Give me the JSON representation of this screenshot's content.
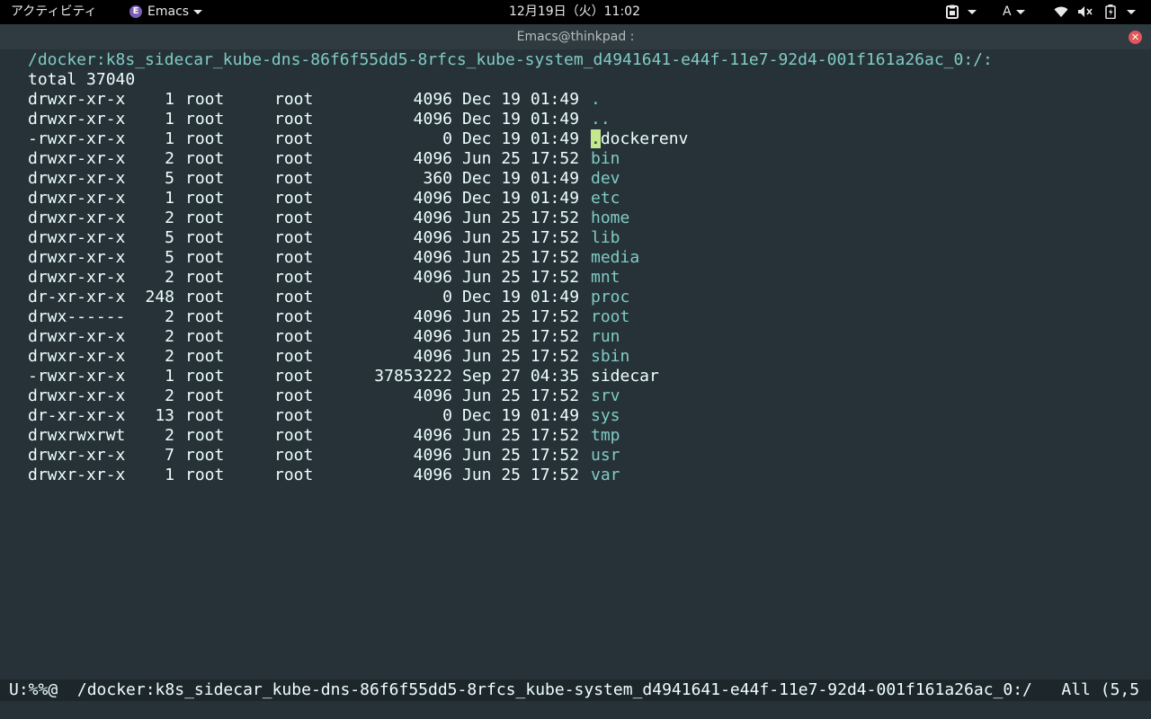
{
  "topbar": {
    "activities": "アクティビティ",
    "app_name": "Emacs",
    "clock": "12月19日（火）11:02",
    "input_method": "A"
  },
  "window": {
    "title": "Emacs@thinkpad :"
  },
  "dired": {
    "header": "/docker:k8s_sidecar_kube-dns-86f6f55dd5-8rfcs_kube-system_d4941641-e44f-11e7-92d4-001f161a26ac_0:/:",
    "total": "total 37040",
    "cursor_char": ".",
    "entries": [
      {
        "perm": "drwxr-xr-x",
        "links": "1",
        "owner": "root",
        "group": "root",
        "size": "4096",
        "date": "Dec 19 01:49",
        "name": "."
      },
      {
        "perm": "drwxr-xr-x",
        "links": "1",
        "owner": "root",
        "group": "root",
        "size": "4096",
        "date": "Dec 19 01:49",
        "name": ".."
      },
      {
        "perm": "-rwxr-xr-x",
        "links": "1",
        "owner": "root",
        "group": "root",
        "size": "0",
        "date": "Dec 19 01:49",
        "name": "dockerenv"
      },
      {
        "perm": "drwxr-xr-x",
        "links": "2",
        "owner": "root",
        "group": "root",
        "size": "4096",
        "date": "Jun 25 17:52",
        "name": "bin"
      },
      {
        "perm": "drwxr-xr-x",
        "links": "5",
        "owner": "root",
        "group": "root",
        "size": "360",
        "date": "Dec 19 01:49",
        "name": "dev"
      },
      {
        "perm": "drwxr-xr-x",
        "links": "1",
        "owner": "root",
        "group": "root",
        "size": "4096",
        "date": "Dec 19 01:49",
        "name": "etc"
      },
      {
        "perm": "drwxr-xr-x",
        "links": "2",
        "owner": "root",
        "group": "root",
        "size": "4096",
        "date": "Jun 25 17:52",
        "name": "home"
      },
      {
        "perm": "drwxr-xr-x",
        "links": "5",
        "owner": "root",
        "group": "root",
        "size": "4096",
        "date": "Jun 25 17:52",
        "name": "lib"
      },
      {
        "perm": "drwxr-xr-x",
        "links": "5",
        "owner": "root",
        "group": "root",
        "size": "4096",
        "date": "Jun 25 17:52",
        "name": "media"
      },
      {
        "perm": "drwxr-xr-x",
        "links": "2",
        "owner": "root",
        "group": "root",
        "size": "4096",
        "date": "Jun 25 17:52",
        "name": "mnt"
      },
      {
        "perm": "dr-xr-xr-x",
        "links": "248",
        "owner": "root",
        "group": "root",
        "size": "0",
        "date": "Dec 19 01:49",
        "name": "proc"
      },
      {
        "perm": "drwx------",
        "links": "2",
        "owner": "root",
        "group": "root",
        "size": "4096",
        "date": "Jun 25 17:52",
        "name": "root"
      },
      {
        "perm": "drwxr-xr-x",
        "links": "2",
        "owner": "root",
        "group": "root",
        "size": "4096",
        "date": "Jun 25 17:52",
        "name": "run"
      },
      {
        "perm": "drwxr-xr-x",
        "links": "2",
        "owner": "root",
        "group": "root",
        "size": "4096",
        "date": "Jun 25 17:52",
        "name": "sbin"
      },
      {
        "perm": "-rwxr-xr-x",
        "links": "1",
        "owner": "root",
        "group": "root",
        "size": "37853222",
        "date": "Sep 27 04:35",
        "name": "sidecar"
      },
      {
        "perm": "drwxr-xr-x",
        "links": "2",
        "owner": "root",
        "group": "root",
        "size": "4096",
        "date": "Jun 25 17:52",
        "name": "srv"
      },
      {
        "perm": "dr-xr-xr-x",
        "links": "13",
        "owner": "root",
        "group": "root",
        "size": "0",
        "date": "Dec 19 01:49",
        "name": "sys"
      },
      {
        "perm": "drwxrwxrwt",
        "links": "2",
        "owner": "root",
        "group": "root",
        "size": "4096",
        "date": "Jun 25 17:52",
        "name": "tmp"
      },
      {
        "perm": "drwxr-xr-x",
        "links": "7",
        "owner": "root",
        "group": "root",
        "size": "4096",
        "date": "Jun 25 17:52",
        "name": "usr"
      },
      {
        "perm": "drwxr-xr-x",
        "links": "1",
        "owner": "root",
        "group": "root",
        "size": "4096",
        "date": "Jun 25 17:52",
        "name": "var"
      }
    ]
  },
  "modeline": {
    "text": "U:%%@  /docker:k8s_sidecar_kube-dns-86f6f55dd5-8rfcs_kube-system_d4941641-e44f-11e7-92d4-001f161a26ac_0:/   All (5,5"
  },
  "colors": {
    "background": "#263238",
    "directory": "#80cbc4",
    "cursor": "#c3e88d",
    "modeline_bg": "#1c262b"
  },
  "icons": [
    "emacs-icon",
    "clipboard-icon",
    "wifi-icon",
    "volume-muted-icon",
    "battery-icon",
    "close-icon"
  ]
}
